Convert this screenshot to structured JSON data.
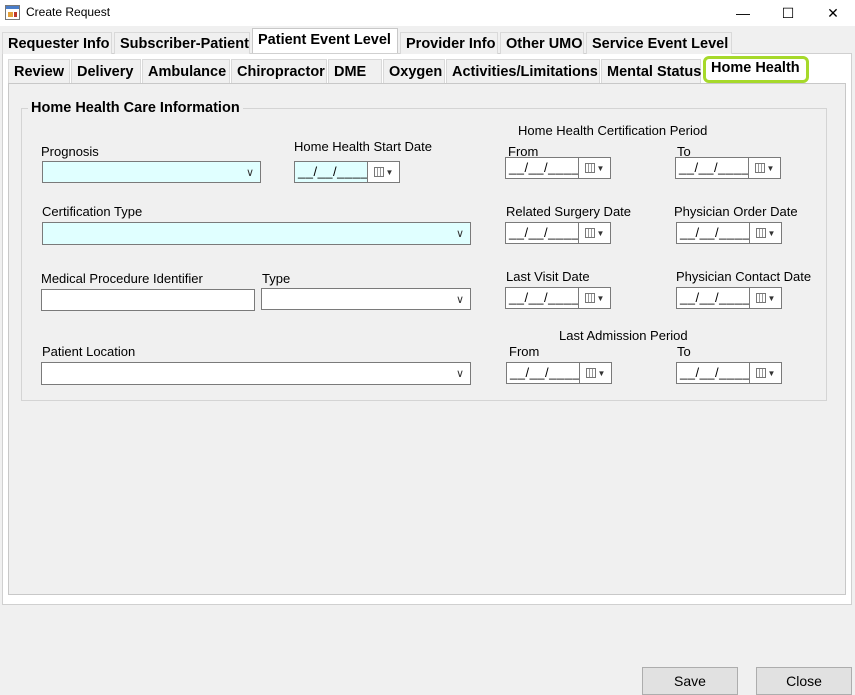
{
  "window": {
    "title": "Create Request",
    "minimize": "—",
    "maximize": "☐",
    "close": "✕"
  },
  "tabs_level1": [
    "Requester Info",
    "Subscriber-Patient",
    "Patient Event Level",
    "Provider Info",
    "Other UMO",
    "Service Event Level"
  ],
  "tabs_level1_active": "Patient Event Level",
  "tabs_level2": [
    "Review",
    "Delivery",
    "Ambulance",
    "Chiropractor",
    "DME",
    "Oxygen",
    "Activities/Limitations",
    "Mental Status",
    "Home Health"
  ],
  "tabs_level2_active": "Home Health",
  "highlight_color": "#a6d92b",
  "group": {
    "title": "Home Health Care Information",
    "prognosis": {
      "label": "Prognosis",
      "value": ""
    },
    "start_date": {
      "label": "Home Health Start Date",
      "value": "__/__/____"
    },
    "cert_period": {
      "label": "Home Health Certification Period",
      "from_label": "From",
      "to_label": "To",
      "from": "__/__/____",
      "to": "__/__/____"
    },
    "cert_type": {
      "label": "Certification Type",
      "value": ""
    },
    "related_surgery": {
      "label": "Related Surgery Date",
      "value": "__/__/____"
    },
    "physician_order": {
      "label": "Physician Order Date",
      "value": "__/__/____"
    },
    "medical_procedure": {
      "label": "Medical Procedure Identifier",
      "value": ""
    },
    "type": {
      "label": "Type",
      "value": ""
    },
    "last_visit": {
      "label": "Last Visit Date",
      "value": "__/__/____"
    },
    "physician_contact": {
      "label": "Physician Contact Date",
      "value": "__/__/____"
    },
    "patient_location": {
      "label": "Patient Location",
      "value": ""
    },
    "last_admission": {
      "label": "Last Admission Period",
      "from_label": "From",
      "to_label": "To",
      "from": "__/__/____",
      "to": "__/__/____"
    }
  },
  "buttons": {
    "save": "Save",
    "close": "Close"
  },
  "required_field_color": "#e0ffff"
}
